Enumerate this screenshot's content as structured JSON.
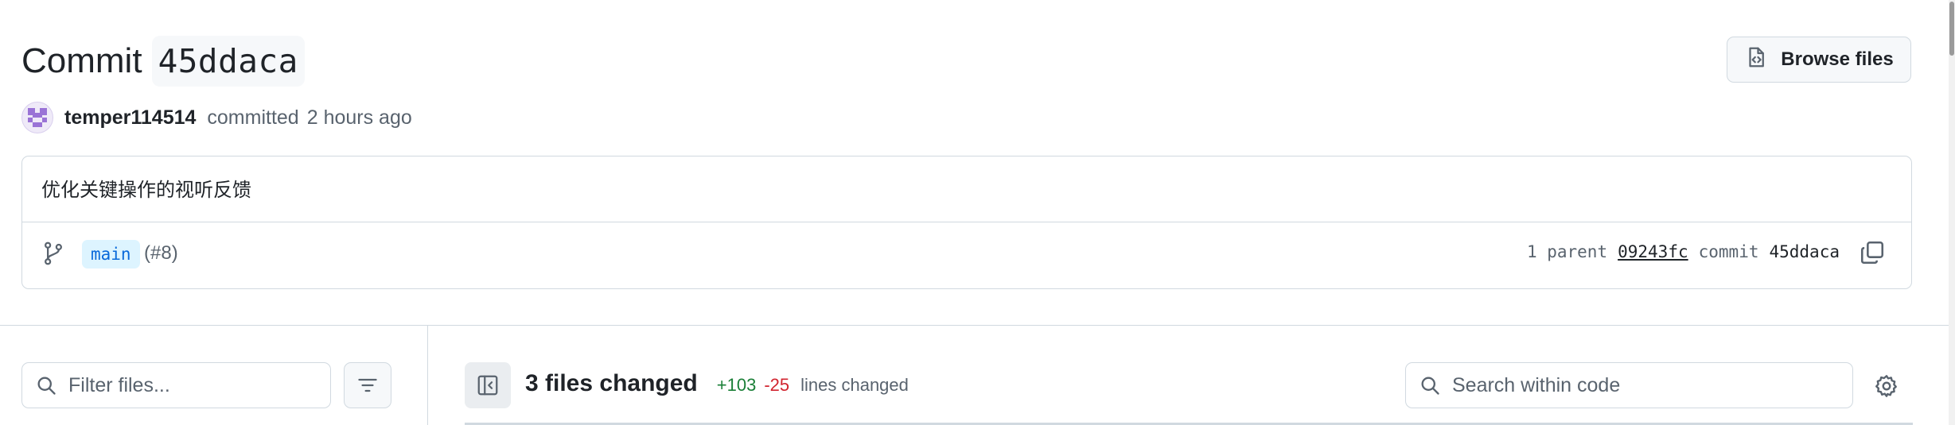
{
  "header": {
    "title_word": "Commit",
    "title_sha": "45ddaca",
    "browse_files_label": "Browse files"
  },
  "author": {
    "name": "temper114514",
    "action": "committed",
    "time": "2 hours ago"
  },
  "commit": {
    "message": "优化关键操作的视听反馈",
    "branch": "main",
    "pr_ref": "(#8)",
    "parent_label": "1 parent",
    "parent_sha": "09243fc",
    "commit_label": "commit",
    "commit_sha": "45ddaca"
  },
  "file_tree": {
    "filter_placeholder": "Filter files..."
  },
  "diff_summary": {
    "files_changed": "3 files changed",
    "additions": "+103",
    "deletions": "-25",
    "lines_changed_label": "lines changed"
  },
  "code_search": {
    "placeholder": "Search within code"
  },
  "colors": {
    "accent_blue": "#0969da",
    "addition_green": "#1a7f37",
    "deletion_red": "#d1242f",
    "border": "#d1d9e0"
  },
  "icons": [
    "browse-code-icon",
    "avatar-identicon",
    "git-branch-icon",
    "copy-icon",
    "search-icon",
    "filter-icon",
    "sidebar-collapse-icon",
    "gear-icon"
  ]
}
